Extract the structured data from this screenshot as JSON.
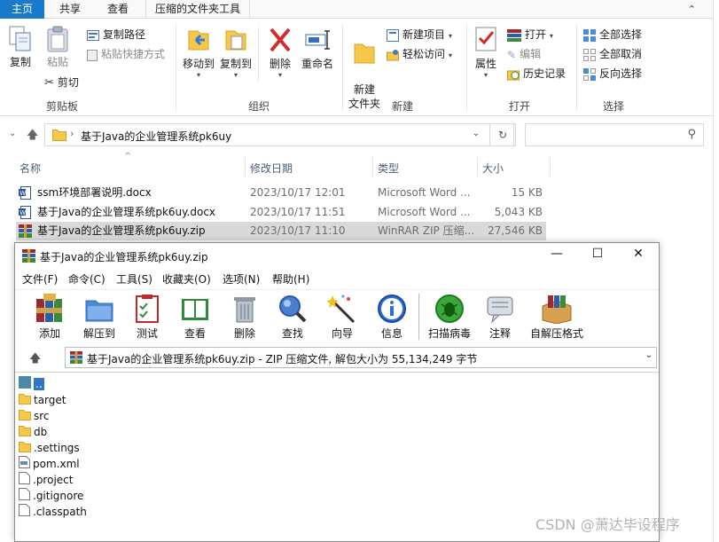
{
  "ribbon_tabs": [
    "主页",
    "共享",
    "查看",
    "压缩的文件夹工具"
  ],
  "ribbon": {
    "clipboard": {
      "label": "剪贴板",
      "copy": "复制",
      "paste": "粘贴",
      "copy_path": "复制路径",
      "paste_shortcut": "粘贴快捷方式",
      "cut": "剪切"
    },
    "organize": {
      "label": "组织",
      "move_to": "移动到",
      "copy_to": "复制到",
      "delete": "删除",
      "rename": "重命名"
    },
    "new": {
      "label": "新建",
      "new_folder": "新建\n文件夹",
      "new_item": "新建项目",
      "easy_access": "轻松访问"
    },
    "open": {
      "label": "打开",
      "properties": "属性",
      "open": "打开",
      "edit": "编辑",
      "history": "历史记录"
    },
    "select": {
      "label": "选择",
      "select_all": "全部选择",
      "select_none": "全部取消",
      "invert": "反向选择"
    }
  },
  "address": {
    "path": "基于Java的企业管理系统pk6uy"
  },
  "columns": {
    "name": "名称",
    "date": "修改日期",
    "type": "类型",
    "size": "大小"
  },
  "files": [
    {
      "name": "ssm环境部署说明.docx",
      "date": "2023/10/17 12:01",
      "type": "Microsoft Word ...",
      "size": "15 KB",
      "icon": "word-icon"
    },
    {
      "name": "基于Java的企业管理系统pk6uy.docx",
      "date": "2023/10/17 11:51",
      "type": "Microsoft Word ...",
      "size": "5,043 KB",
      "icon": "word-icon"
    },
    {
      "name": "基于Java的企业管理系统pk6uy.zip",
      "date": "2023/10/17 11:10",
      "type": "WinRAR ZIP 压缩...",
      "size": "27,546 KB",
      "icon": "winrar-icon"
    }
  ],
  "rar": {
    "title": "基于Java的企业管理系统pk6uy.zip",
    "menu": [
      "文件(F)",
      "命令(C)",
      "工具(S)",
      "收藏夹(O)",
      "选项(N)",
      "帮助(H)"
    ],
    "toolbar": [
      "添加",
      "解压到",
      "测试",
      "查看",
      "删除",
      "查找",
      "向导",
      "信息",
      "扫描病毒",
      "注释",
      "自解压格式"
    ],
    "path": "基于Java的企业管理系统pk6uy.zip - ZIP 压缩文件, 解包大小为 55,134,249 字节",
    "items": [
      {
        "name": "..",
        "kind": "up"
      },
      {
        "name": "target",
        "kind": "folder"
      },
      {
        "name": "src",
        "kind": "folder"
      },
      {
        "name": "db",
        "kind": "folder"
      },
      {
        "name": ".settings",
        "kind": "folder"
      },
      {
        "name": "pom.xml",
        "kind": "xml"
      },
      {
        "name": ".project",
        "kind": "file"
      },
      {
        "name": ".gitignore",
        "kind": "file"
      },
      {
        "name": ".classpath",
        "kind": "file"
      }
    ]
  },
  "watermark": "CSDN @萧达毕设程序",
  "colors": {
    "tab_active": "#1979ca",
    "selection": "#d9d9d9",
    "rar_up_highlight": "#3274c4"
  }
}
